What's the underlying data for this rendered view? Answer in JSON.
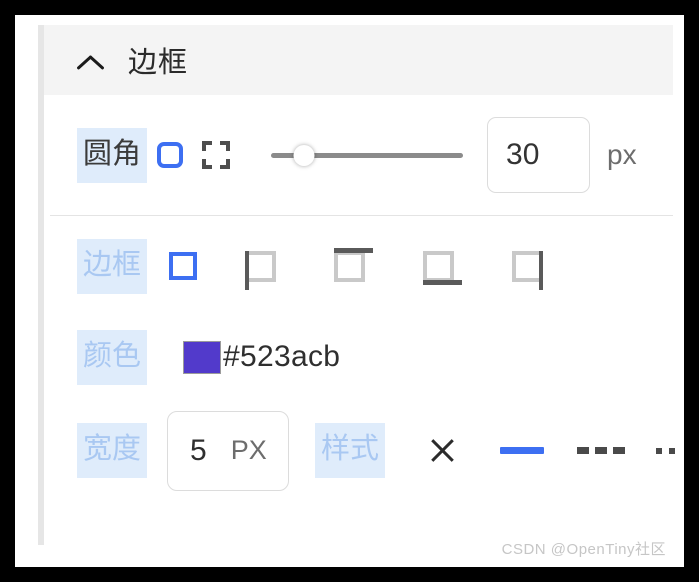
{
  "panel": {
    "title": "边框",
    "collapse_icon": "chevron-up-icon"
  },
  "radius": {
    "label": "圆角",
    "mode_all_icon": "rounded-square-icon",
    "mode_corners_icon": "corner-brackets-icon",
    "slider_value_percent": 17,
    "value": "30",
    "unit": "px"
  },
  "sides": {
    "label": "边框",
    "options": [
      {
        "name": "all",
        "icon": "square-all-borders-icon",
        "selected": true
      },
      {
        "name": "left",
        "icon": "square-left-border-icon",
        "selected": false
      },
      {
        "name": "top",
        "icon": "square-top-border-icon",
        "selected": false
      },
      {
        "name": "bottom",
        "icon": "square-bottom-border-icon",
        "selected": false
      },
      {
        "name": "right",
        "icon": "square-right-border-icon",
        "selected": false
      }
    ]
  },
  "color": {
    "label": "颜色",
    "value": "#523acb",
    "swatch_hex": "#523acb"
  },
  "width": {
    "label": "宽度",
    "value": "5",
    "unit": "PX"
  },
  "style": {
    "label": "样式",
    "options": [
      {
        "name": "none",
        "icon": "x-icon",
        "selected": false
      },
      {
        "name": "solid",
        "icon": "solid-line-icon",
        "selected": true
      },
      {
        "name": "dashed",
        "icon": "dashed-line-icon",
        "selected": false
      },
      {
        "name": "dotted",
        "icon": "dotted-line-icon",
        "selected": false
      }
    ]
  },
  "watermark": "CSDN @OpenTiny社区",
  "colors": {
    "accent_blue": "#3d6ff2",
    "chip_bg": "#dfecfb",
    "chip_ghost_text": "#a9c8f2",
    "header_bg": "#f4f4f4"
  }
}
